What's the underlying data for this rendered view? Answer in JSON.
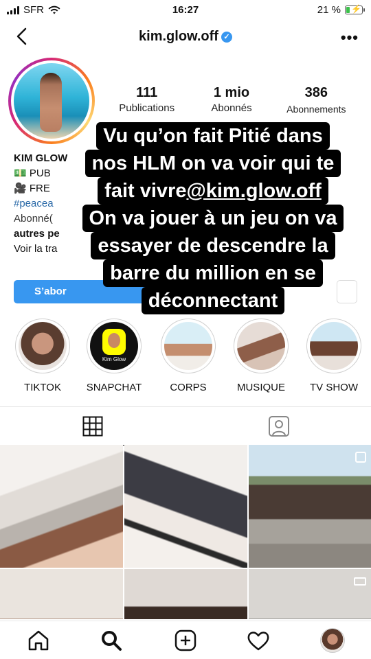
{
  "status_bar": {
    "carrier": "SFR",
    "time": "16:27",
    "battery_text": "21 %",
    "battery_level": 0.21,
    "battery_color": "#3bc14a"
  },
  "header": {
    "username": "kim.glow.off",
    "verified": true,
    "back_icon": "chevron-left-icon",
    "more_icon": "more-horizontal-icon",
    "more_glyph": "•••"
  },
  "profile": {
    "stats": [
      {
        "value": "111",
        "label": "Publications"
      },
      {
        "value": "1 mio",
        "label": "Abonnés"
      },
      {
        "value": "386",
        "label": "Abonnements"
      }
    ],
    "bio": {
      "name": "KIM GLOW",
      "line1": "PUB",
      "line2": "FRE",
      "hashtag": "#peacea",
      "followed_by": "Abonné(",
      "others": "autres pe",
      "translate": "Voir la tra"
    },
    "follow_button": "S’abor"
  },
  "highlights": [
    {
      "label": "TIKTOK"
    },
    {
      "label": "SNAPCHAT",
      "badge": "Kim Glow"
    },
    {
      "label": "CORPS"
    },
    {
      "label": "MUSIQUE"
    },
    {
      "label": "TV SHOW"
    }
  ],
  "tabs": [
    {
      "icon": "grid-icon",
      "active": true
    },
    {
      "icon": "tagged-user-icon",
      "active": false
    }
  ],
  "overlay": {
    "lines": [
      "Vu qu’on fait Pitié dans",
      "nos HLM on va voir qui te",
      "fait vivre ",
      "On va jouer à un jeu on va",
      "essayer de descendre la",
      "barre du million en se",
      "déconnectant"
    ],
    "mention": "@kim.glow.off"
  },
  "bottom_nav": [
    {
      "icon": "home-icon"
    },
    {
      "icon": "search-icon"
    },
    {
      "icon": "add-post-icon"
    },
    {
      "icon": "heart-icon"
    },
    {
      "icon": "profile-avatar-icon"
    }
  ],
  "colors": {
    "accent": "#3897f0",
    "link": "#2b6aa8",
    "overlay_bg": "#000000"
  }
}
